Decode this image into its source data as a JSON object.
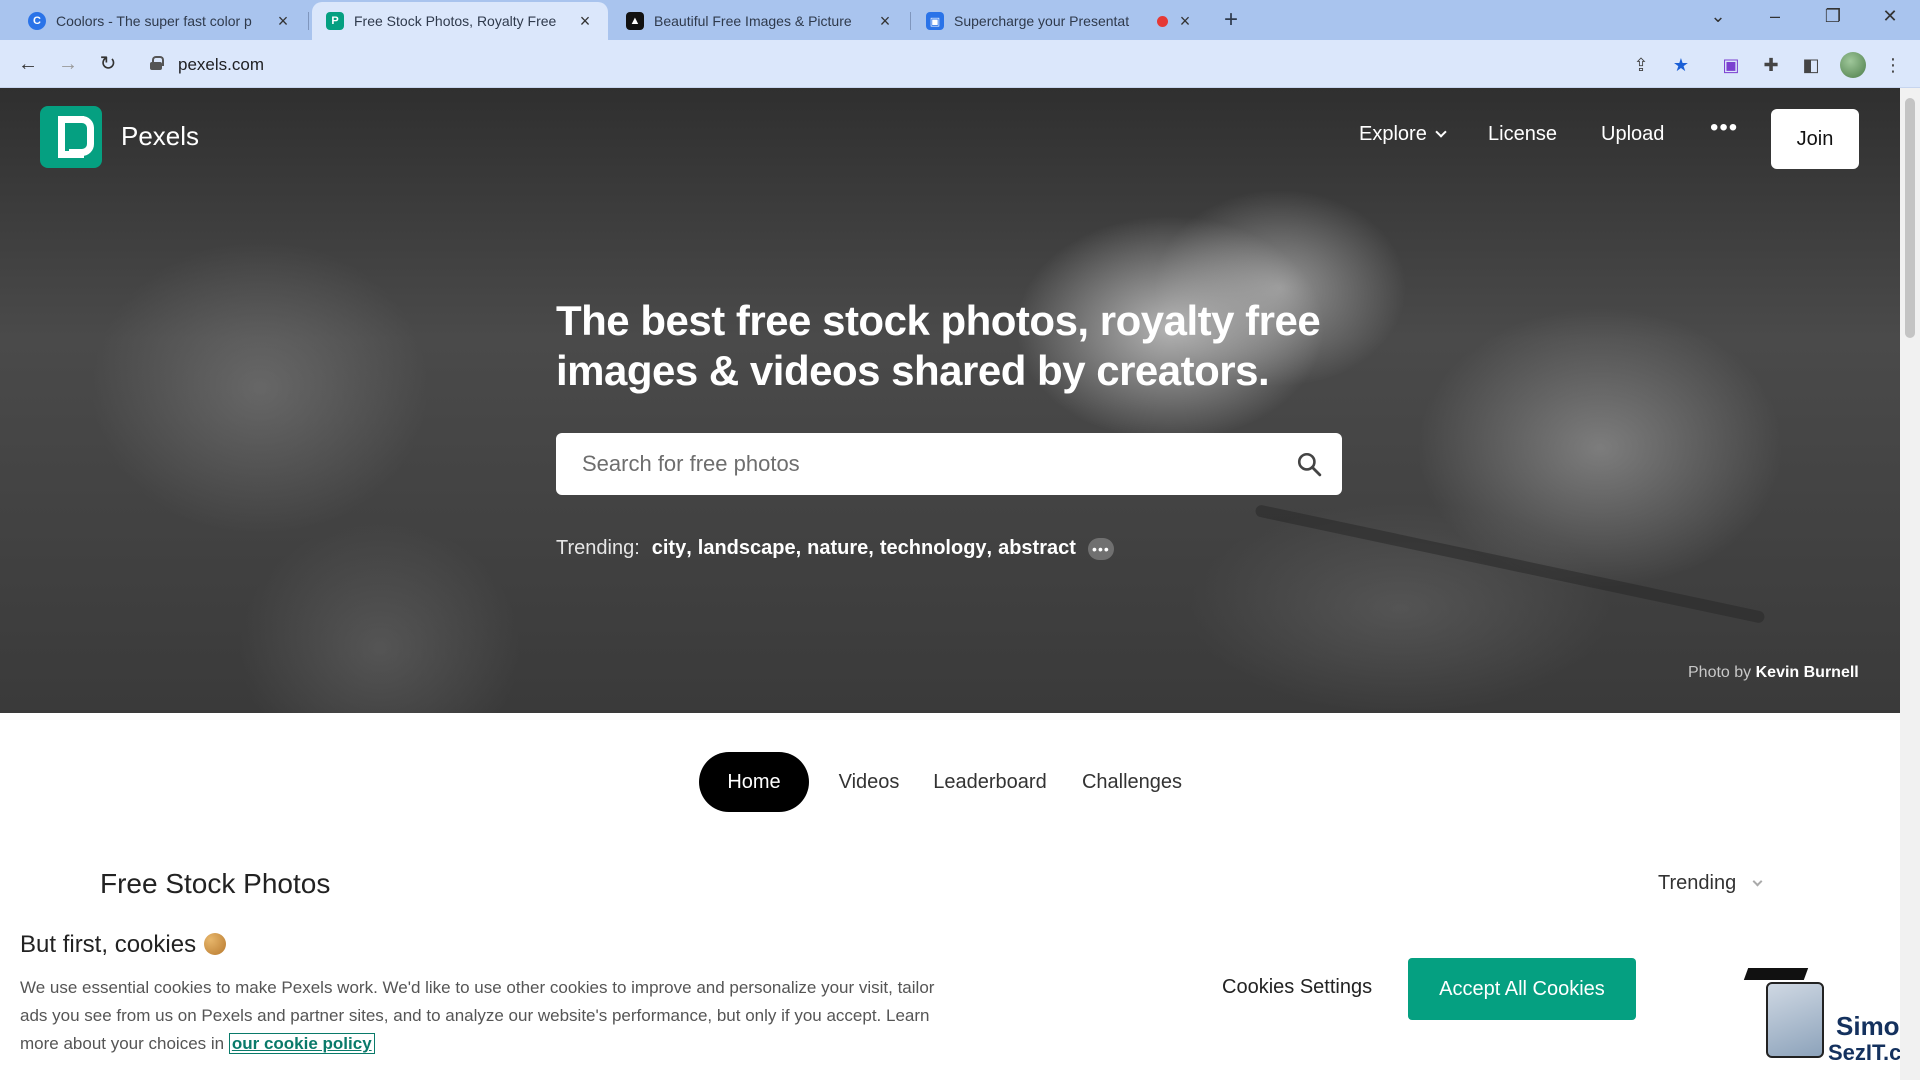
{
  "browser": {
    "tabs": [
      {
        "title": "Coolors - The super fast color p",
        "favicon": "coolors-icon",
        "color": "#2a73e8",
        "active": false
      },
      {
        "title": "Free Stock Photos, Royalty Free",
        "favicon": "pexels-icon",
        "color": "#05a081",
        "active": true
      },
      {
        "title": "Beautiful Free Images & Picture",
        "favicon": "unsplash-icon",
        "color": "#111111",
        "active": false
      },
      {
        "title": "Supercharge your Presentat",
        "favicon": "slides-icon",
        "color": "#2a73e8",
        "active": false,
        "recording": true
      }
    ],
    "url": "pexels.com"
  },
  "header": {
    "brand": "Pexels",
    "nav": {
      "explore": "Explore",
      "license": "License",
      "upload": "Upload",
      "more": "•••",
      "join": "Join"
    }
  },
  "hero": {
    "headline_line1": "The best free stock photos, royalty free",
    "headline_line2": "images & videos shared by creators.",
    "search_placeholder": "Search for free photos",
    "trending_label": "Trending:",
    "trending_tags": [
      "city",
      "landscape",
      "nature",
      "technology",
      "abstract"
    ],
    "trending_more": "•••",
    "credit_prefix": "Photo by",
    "credit_name": "Kevin Burnell"
  },
  "tabs": {
    "home": "Home",
    "videos": "Videos",
    "leaderboard": "Leaderboard",
    "challenges": "Challenges"
  },
  "main": {
    "section_title": "Free Stock Photos",
    "sort_label": "Trending"
  },
  "cookie": {
    "title": "But first, cookies",
    "body": "We use essential cookies to make Pexels work. We'd like to use other cookies to improve and personalize your visit, tailor ads you see from us on Pexels and partner sites, and to analyze our website's performance, but only if you accept. Learn more about your choices in",
    "link": "our cookie policy",
    "settings": "Cookies Settings",
    "accept": "Accept All Cookies"
  },
  "watermark": {
    "name": "Simon",
    "site": "SezIT.com"
  },
  "colors": {
    "brand": "#05a081",
    "tabbar": "#a9c4ee",
    "addressbar": "#dbe7fb"
  }
}
